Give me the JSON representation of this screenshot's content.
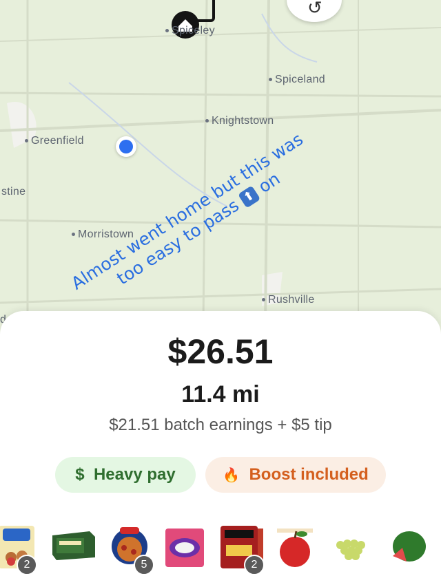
{
  "map": {
    "places": {
      "top_town": "Spiceley",
      "spiceland": "Spiceland",
      "knightstown": "Knightstown",
      "greenfield": "Greenfield",
      "west_edge": "stine",
      "morristown": "Morristown",
      "rushville": "Rushville",
      "left_edge": "d"
    },
    "overlay_text": {
      "line1": "Almost went home but this was",
      "line2_a": "too easy to pass",
      "line2_b": "on",
      "emoji": "⬆"
    }
  },
  "offer": {
    "price": "$26.51",
    "distance": "11.4 mi",
    "breakdown": "$21.51 batch earnings + $5 tip",
    "badges": [
      {
        "icon": "$",
        "label": "Heavy pay"
      },
      {
        "icon": "🔥",
        "label": "Boost included"
      }
    ]
  },
  "items": [
    {
      "name": "Little Bites",
      "qty": "2"
    },
    {
      "name": "Green Tea",
      "qty": ""
    },
    {
      "name": "Jack's Pizza",
      "qty": "5"
    },
    {
      "name": "Nerds",
      "qty": ""
    },
    {
      "name": "On The Border",
      "qty": "2"
    },
    {
      "name": "Apple",
      "qty": ""
    },
    {
      "name": "Grapes",
      "qty": ""
    },
    {
      "name": "Watermelon",
      "qty": ""
    }
  ],
  "colors": {
    "accent_blue": "#2d6ff0",
    "pay_green": "#2f6e2f",
    "boost_orange": "#d45f1e"
  }
}
